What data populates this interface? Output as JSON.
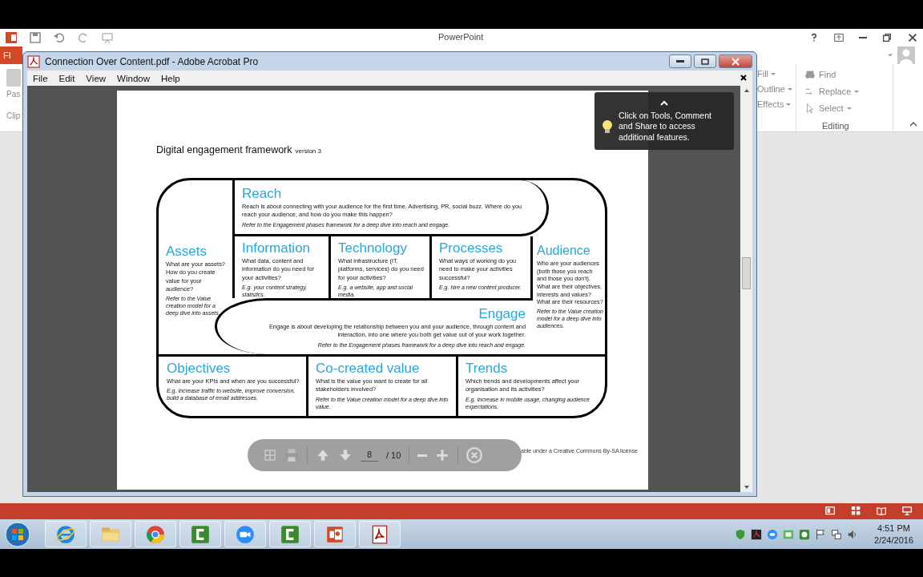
{
  "powerpoint": {
    "title": "PowerPoint",
    "file_tab": "FI",
    "ribbon_left": [
      "Pas",
      "Clip"
    ],
    "format_items": [
      "Fill",
      "Outline",
      "Effects"
    ],
    "editing_items": [
      "Find",
      "Replace",
      "Select"
    ],
    "editing_label": "Editing"
  },
  "acrobat": {
    "title": "Connection Over Content.pdf - Adobe Acrobat Pro",
    "menu": [
      "File",
      "Edit",
      "View",
      "Window",
      "Help"
    ],
    "tooltip": "Click on Tools, Comment and Share to access additional features.",
    "page": {
      "title": "Digital engagement framework",
      "version": "version 3",
      "blocks": [
        {
          "kind": "reach",
          "heading": "Reach",
          "text": "Reach is about connecting with your audience for the first time. Advertising, PR, social buzz. Where do you reach your audience, and how do you make this happen?",
          "note": "Refer to the Engagement phases framework for a deep dive into reach and engage."
        },
        {
          "kind": "assets",
          "heading": "Assets",
          "text": "What are your assets? How do you create value for your audience?",
          "note": "Refer to the Value creation model for a deep dive into assets."
        },
        {
          "kind": "information",
          "heading": "Information",
          "text": "What data, content and information do you need for your activities?",
          "note": "E.g. your content strategy, statistics."
        },
        {
          "kind": "technology",
          "heading": "Technology",
          "text": "What infrastructure (IT, platforms, services) do you need for your activities?",
          "note": "E.g. a website, app and social media."
        },
        {
          "kind": "processes",
          "heading": "Processes",
          "text": "What ways of working do you need to make your activities successful?",
          "note": "E.g. hire a new content producer."
        },
        {
          "kind": "engage",
          "heading": "Engage",
          "text": "Engage is about developing the relationship between you and your audience, through content and interaction, into one where you both get value out of your work together.",
          "note": "Refer to the Engagement phases framework for a deep dive into reach and engage."
        },
        {
          "kind": "audience",
          "heading": "Audience",
          "text": "Who are your audiences (both those you reach and those you don't). What are their objectives, interests and values? What are their resources?",
          "note": "Refer to the Value creation model for a deep dive into audiences."
        },
        {
          "kind": "objectives",
          "heading": "Objectives",
          "text": "What are your KPIs and when are you successful?",
          "note": "E.g. Increase traffic to website, improve conversion, build a database of email addresses."
        },
        {
          "kind": "value",
          "heading": "Co-created value",
          "text": "What is the value you want to create for all stakeholders involved?",
          "note": "Refer to the Value creation model for a deep dive into value."
        },
        {
          "kind": "trends",
          "heading": "Trends",
          "text": "Which trends and developments affect your organisation and its activities?",
          "note": "E.g. Increase in mobile usage, changing audience expectations."
        }
      ],
      "footer": "able under a Creative Commons By-SA license"
    },
    "toolbar": {
      "page": "8",
      "total": "/ 10"
    }
  },
  "taskbar": {
    "apps": [
      {
        "kind": "ie"
      },
      {
        "kind": "folder"
      },
      {
        "kind": "chrome"
      },
      {
        "kind": "camtasia"
      },
      {
        "kind": "zoom"
      },
      {
        "kind": "camtasia"
      },
      {
        "kind": "powerpoint"
      },
      {
        "kind": "acrobat"
      }
    ],
    "time": "4:51 PM",
    "date": "2/24/2016"
  }
}
